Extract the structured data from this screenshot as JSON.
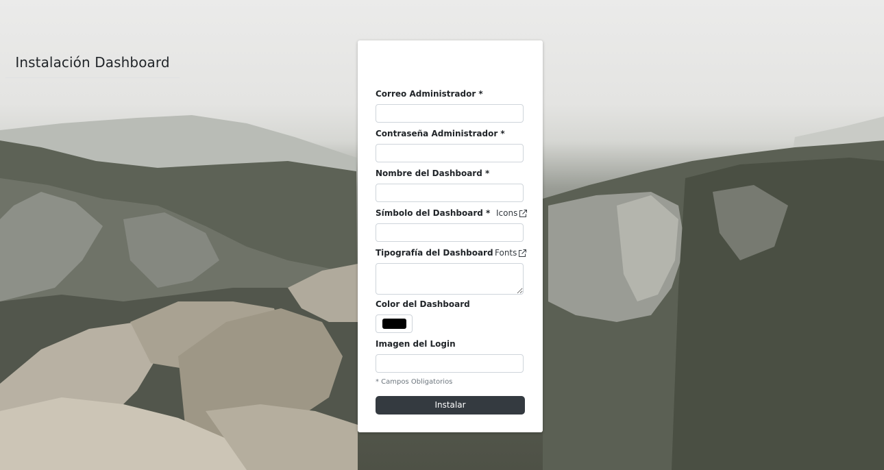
{
  "page": {
    "title": "Instalación Dashboard"
  },
  "form": {
    "admin_email": {
      "label": "Correo Administrador *",
      "value": "",
      "placeholder": ""
    },
    "admin_password": {
      "label": "Contraseña Administrador *",
      "value": "",
      "placeholder": ""
    },
    "dashboard_name": {
      "label": "Nombre del Dashboard *",
      "value": "",
      "placeholder": ""
    },
    "dashboard_symbol": {
      "label": "Símbolo del Dashboard *",
      "value": "",
      "placeholder": "",
      "link_label": "Icons",
      "link_icon": "external-link-icon"
    },
    "dashboard_typography": {
      "label": "Tipografía del Dashboard",
      "value": "",
      "placeholder": "",
      "link_label": "Fonts",
      "link_icon": "external-link-icon"
    },
    "dashboard_color": {
      "label": "Color del Dashboard",
      "value": "#000000"
    },
    "login_image": {
      "label": "Imagen del Login",
      "value": "",
      "placeholder": ""
    },
    "required_note": "* Campos Obligatorios",
    "submit_label": "Instalar"
  },
  "colors": {
    "button": "#343a40",
    "card": "#ffffff",
    "swatch": "#000000"
  }
}
